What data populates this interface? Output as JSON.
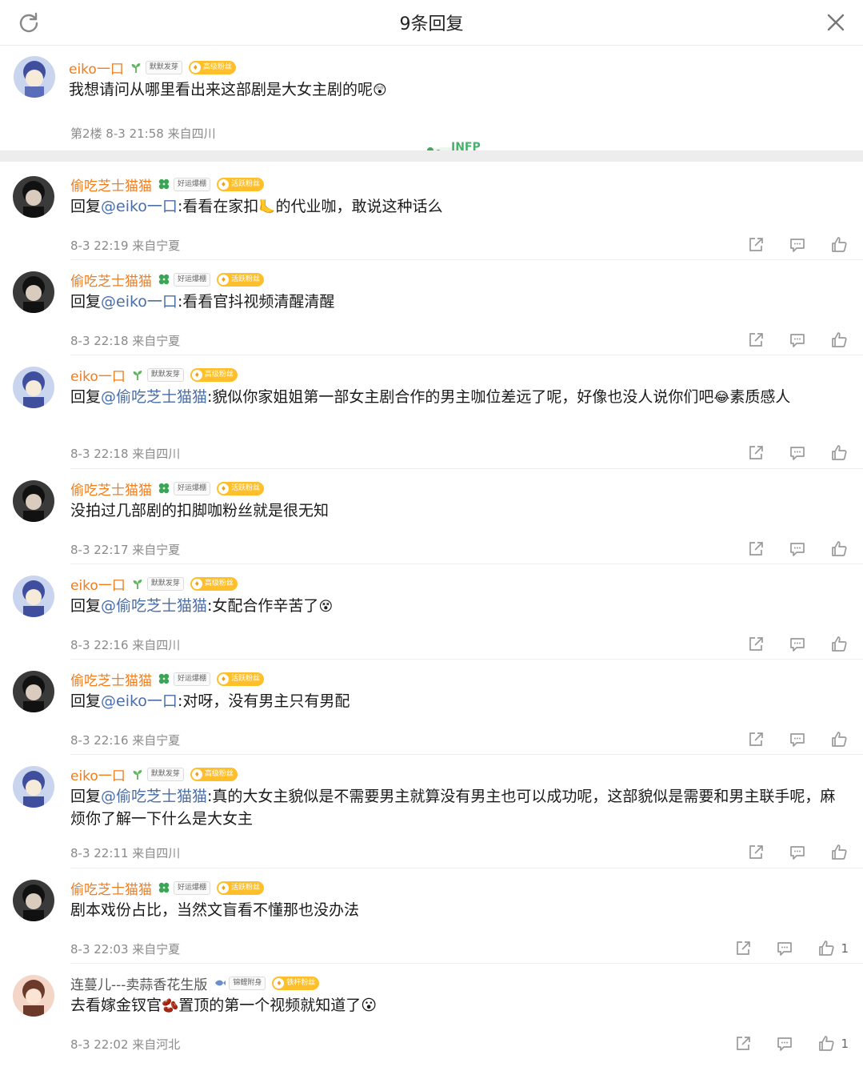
{
  "header": {
    "title": "9条回复",
    "refresh_icon": "refresh-icon",
    "close_icon": "close-icon"
  },
  "root": {
    "user": "eiko一口",
    "badge1": "默默发芽",
    "badge2": "高级粉丝",
    "text": "我想请问从哪里看出来这部剧是大女主剧的呢",
    "emoji": "😲",
    "sticker": "INFP",
    "meta": "第2楼 8-3 21:58 来自四川"
  },
  "colors": {
    "username": "#f07d1e",
    "mention": "#4a6ea8",
    "meta": "#8a8a8a",
    "badge": "#ffbf2b"
  },
  "replies": [
    {
      "user": "偷吃芝士猫猫",
      "badge1": "好运爆棚",
      "badge2": "活跃粉丝",
      "prefix": "回复",
      "mention": "@eiko一口",
      "body": ":看看在家扣",
      "emoji": "🦶",
      "body2": "的代业咖，敢说这种话么",
      "meta": "8-3 22:19 来自宁夏",
      "likes": ""
    },
    {
      "user": "偷吃芝士猫猫",
      "badge1": "好运爆棚",
      "badge2": "活跃粉丝",
      "prefix": "回复",
      "mention": "@eiko一口",
      "body": ":看看官抖视频清醒清醒",
      "emoji": "",
      "body2": "",
      "meta": "8-3 22:18 来自宁夏",
      "likes": ""
    },
    {
      "user": "eiko一口",
      "badge1": "默默发芽",
      "badge2": "高级粉丝",
      "prefix": "回复",
      "mention": "@偷吃芝士猫猫",
      "body": ":貌似你家姐姐第一部女主剧合作的男主咖位差远了呢，好像也没人说你们吧",
      "emoji": "😂",
      "body2": "素质感人",
      "meta": "8-3 22:18 来自四川",
      "likes": ""
    },
    {
      "user": "偷吃芝士猫猫",
      "badge1": "好运爆棚",
      "badge2": "活跃粉丝",
      "prefix": "",
      "mention": "",
      "body": "没拍过几部剧的扣脚咖粉丝就是很无知",
      "emoji": "",
      "body2": "",
      "meta": "8-3 22:17 来自宁夏",
      "likes": ""
    },
    {
      "user": "eiko一口",
      "badge1": "默默发芽",
      "badge2": "高级粉丝",
      "prefix": "回复",
      "mention": "@偷吃芝士猫猫",
      "body": ":女配合作辛苦了",
      "emoji": "😵",
      "body2": "",
      "meta": "8-3 22:16 来自四川",
      "likes": ""
    },
    {
      "user": "偷吃芝士猫猫",
      "badge1": "好运爆棚",
      "badge2": "活跃粉丝",
      "prefix": "回复",
      "mention": "@eiko一口",
      "body": ":对呀，没有男主只有男配",
      "emoji": "",
      "body2": "",
      "meta": "8-3 22:16 来自宁夏",
      "likes": ""
    },
    {
      "user": "eiko一口",
      "badge1": "默默发芽",
      "badge2": "高级粉丝",
      "prefix": "回复",
      "mention": "@偷吃芝士猫猫",
      "body": ":真的大女主貌似是不需要男主就算没有男主也可以成功呢，这部貌似是需要和男主联手呢，麻烦你了解一下什么是大女主",
      "emoji": "",
      "body2": "",
      "meta": "8-3 22:11 来自四川",
      "likes": ""
    },
    {
      "user": "偷吃芝士猫猫",
      "badge1": "好运爆棚",
      "badge2": "活跃粉丝",
      "prefix": "",
      "mention": "",
      "body": "剧本戏份占比，当然文盲看不懂那也没办法",
      "emoji": "",
      "body2": "",
      "meta": "8-3 22:03 来自宁夏",
      "likes": "1"
    },
    {
      "user": "连蔓儿---卖蒜香花生版",
      "badge1": "锦鲤附身",
      "badge2": "铁杆粉丝",
      "prefix": "",
      "mention": "",
      "body": "去看嫁金钗官",
      "emoji": "🫘",
      "body2": "置顶的第一个视频就知道了😮",
      "meta": "8-3 22:02 来自河北",
      "likes": "1"
    }
  ]
}
